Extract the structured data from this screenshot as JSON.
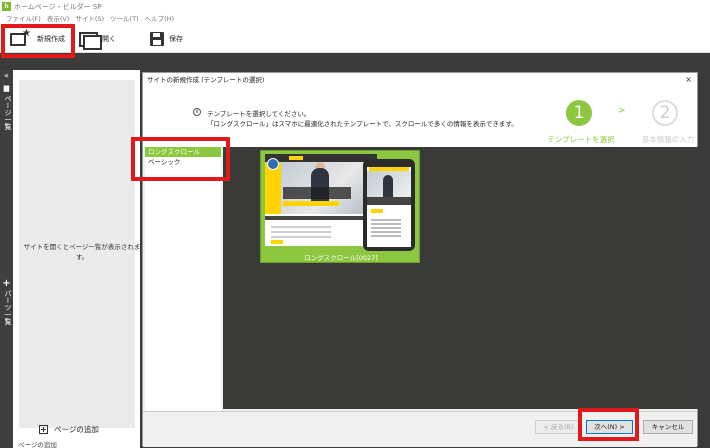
{
  "window": {
    "title": "ホームページ・ビルダー SP",
    "app_icon": "h"
  },
  "menu": {
    "items": [
      "ファイル(F)",
      "表示(V)",
      "サイト(S)",
      "ツール(T)",
      "ヘルプ(H)"
    ]
  },
  "toolbar": {
    "new_label": "新規作成",
    "open_label": "開く",
    "save_label": "保存"
  },
  "left_strip": {
    "collapse": "«",
    "page_list_label": "ページ一覧",
    "parts_plus": "+",
    "parts_list_label": "パーツ一覧"
  },
  "page_panel": {
    "message": "サイトを開くとページ一覧が表示されます。",
    "add_page_label": "ページの追加",
    "bottom_label": "ページの追加"
  },
  "dialog": {
    "title": "サイトの新規作成 (テンプレートの選択)",
    "close": "×",
    "info_icon": "i",
    "info_line1": "テンプレートを選択してください。",
    "info_line2": "「ロングスクロール」はスマホに最適化されたテンプレートで、スクロールで多くの情報を表示できます。",
    "steps": [
      {
        "number": "1",
        "label": "テンプレートを選択",
        "active": true
      },
      {
        "number": "2",
        "label": "基本情報の入力",
        "active": false
      }
    ],
    "step_arrow": ">",
    "template_categories": [
      {
        "label": "ロングスクロール",
        "selected": true
      },
      {
        "label": "ベーシック",
        "selected": false
      }
    ],
    "template_card_label": "ロングスクロール[0027]",
    "buttons": {
      "back": "< 戻る(B)",
      "next": "次へ(N) >",
      "cancel": "キャンセル"
    }
  },
  "colors": {
    "accent_green": "#8dc63f",
    "highlight_red": "#e0191b",
    "dark_bg": "#3a3a3a"
  }
}
